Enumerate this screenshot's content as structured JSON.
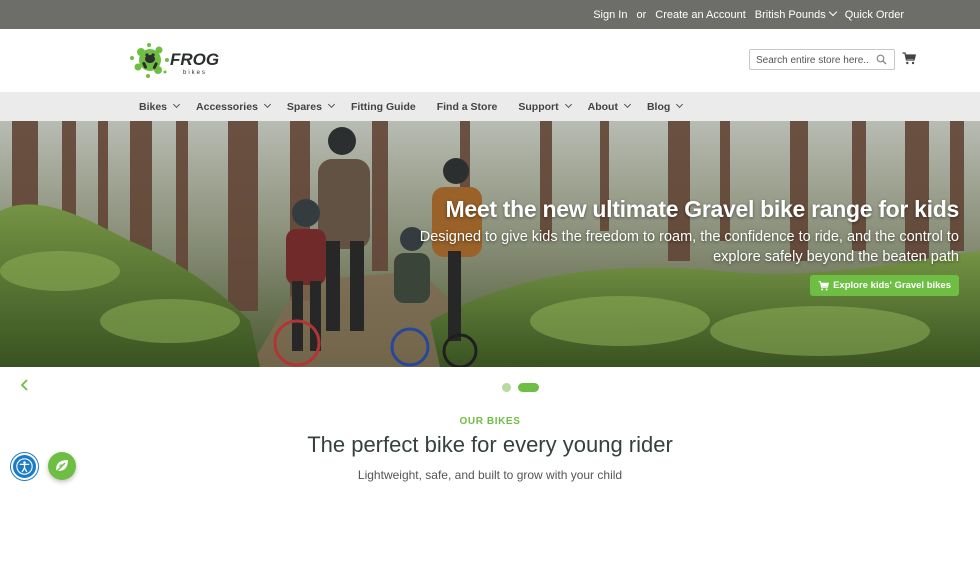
{
  "topbar": {
    "sign_in": "Sign In",
    "or": "or",
    "create_account": "Create an Account",
    "currency": "British Pounds",
    "quick_order": "Quick Order"
  },
  "header": {
    "logo_text": "FROG",
    "logo_sub": "bikes",
    "search_placeholder": "Search entire store here..."
  },
  "nav": {
    "items": [
      {
        "label": "Bikes",
        "dropdown": true
      },
      {
        "label": "Accessories",
        "dropdown": true
      },
      {
        "label": "Spares",
        "dropdown": true
      },
      {
        "label": "Fitting Guide",
        "dropdown": false
      },
      {
        "label": "Find a Store",
        "dropdown": false
      },
      {
        "label": "Support",
        "dropdown": true
      },
      {
        "label": "About",
        "dropdown": true
      },
      {
        "label": "Blog",
        "dropdown": true
      }
    ]
  },
  "hero": {
    "title": "Meet the new ultimate Gravel bike range for kids",
    "subtitle": "Designed to give kids the freedom to roam, the confidence to ride, and the control to explore safely beyond the beaten path",
    "cta": "Explore kids' Gravel bikes",
    "slide_count": 2,
    "active_slide": 2
  },
  "section": {
    "kicker": "OUR BIKES",
    "heading": "The perfect bike for every young rider",
    "subheading": "Lightweight, safe, and built to grow with your child"
  },
  "colors": {
    "brand_green": "#6fbe44",
    "topbar_bg": "#6d6e6a",
    "nav_bg": "#ebebeb",
    "accessibility_blue": "#1a7bc7"
  },
  "icons": [
    "chevron-down-icon",
    "search-icon",
    "cart-icon",
    "chevron-left-icon",
    "accessibility-icon",
    "chat-icon"
  ]
}
